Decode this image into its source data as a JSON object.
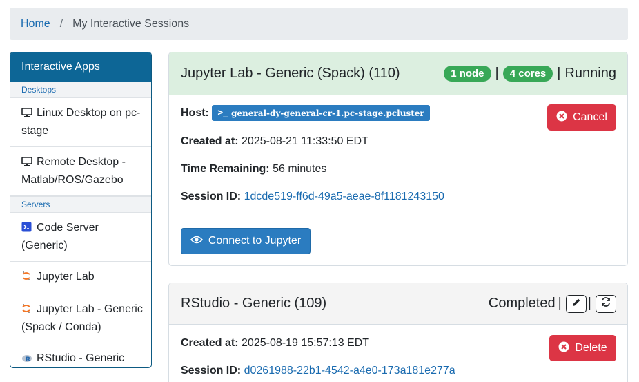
{
  "breadcrumb": {
    "home": "Home",
    "separator": "/",
    "current": "My Interactive Sessions"
  },
  "sidebar": {
    "header": "Interactive Apps",
    "sections": [
      {
        "label": "Desktops",
        "items": [
          {
            "label": "Linux Desktop on pc-stage",
            "icon": "monitor-icon"
          },
          {
            "label": "Remote Desktop - Matlab/ROS/Gazebo",
            "icon": "monitor-icon"
          }
        ]
      },
      {
        "label": "Servers",
        "items": [
          {
            "label": "Code Server (Generic)",
            "icon": "vscode-icon"
          },
          {
            "label": "Jupyter Lab",
            "icon": "jupyter-icon"
          },
          {
            "label": "Jupyter Lab - Generic (Spack / Conda)",
            "icon": "jupyter-icon"
          },
          {
            "label": "RStudio - Generic",
            "icon": "rstudio-icon"
          }
        ]
      }
    ]
  },
  "sessions": [
    {
      "title": "Jupyter Lab - Generic (Spack) (110)",
      "nodes": "1 node",
      "cores": "4 cores",
      "separator": "|",
      "status": "Running",
      "host_label": "Host:",
      "host": "general-dy-general-cr-1.pc-stage.pcluster",
      "created_label": "Created at:",
      "created": "2025-08-21 11:33:50 EDT",
      "remaining_label": "Time Remaining:",
      "remaining": "56 minutes",
      "session_label": "Session ID:",
      "session_id": "1dcde519-ff6d-49a5-aeae-8f1181243150",
      "cancel_label": "Cancel",
      "connect_label": "Connect to Jupyter"
    },
    {
      "title": "RStudio - Generic (109)",
      "status": "Completed",
      "separator": "|",
      "created_label": "Created at:",
      "created": "2025-08-19 15:57:13 EDT",
      "session_label": "Session ID:",
      "session_id": "d0261988-22b1-4542-a4e0-173a181e277a",
      "delete_label": "Delete"
    }
  ],
  "colors": {
    "primary": "#2b7cc0",
    "danger": "#dc3545",
    "success": "#38a857",
    "sidebar_header": "#0d6696",
    "running_header": "#dcefe0"
  }
}
